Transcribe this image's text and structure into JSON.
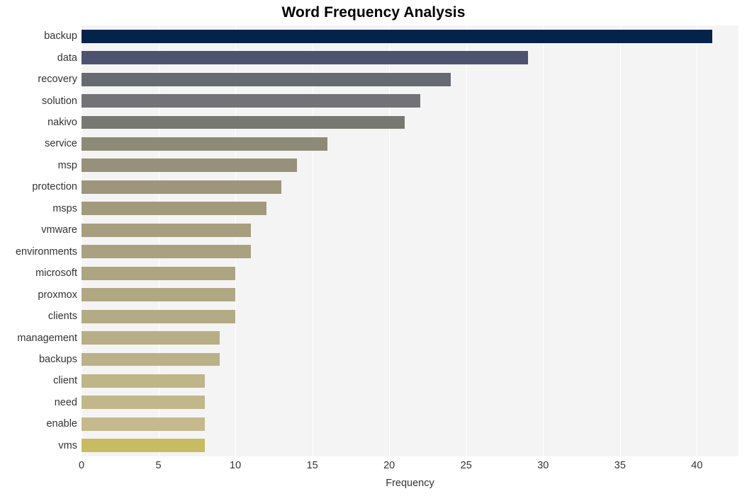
{
  "chart_data": {
    "type": "bar",
    "orientation": "horizontal",
    "title": "Word Frequency Analysis",
    "xlabel": "Frequency",
    "ylabel": "",
    "xlim": [
      0,
      42.7
    ],
    "xticks": [
      0,
      5,
      10,
      15,
      20,
      25,
      30,
      35,
      40
    ],
    "xticklabels": [
      "0",
      "5",
      "10",
      "15",
      "20",
      "25",
      "30",
      "35",
      "40"
    ],
    "grid": "vertical-only",
    "legend": "none",
    "categories": [
      "backup",
      "data",
      "recovery",
      "solution",
      "nakivo",
      "service",
      "msp",
      "protection",
      "msps",
      "vmware",
      "environments",
      "microsoft",
      "proxmox",
      "clients",
      "management",
      "backups",
      "client",
      "need",
      "enable",
      "vms"
    ],
    "values": [
      41,
      29,
      24,
      22,
      21,
      16,
      14,
      13,
      12,
      11,
      11,
      10,
      10,
      10,
      9,
      9,
      8,
      8,
      8,
      8
    ],
    "bar_colors": [
      "#03234b",
      "#4d5271",
      "#666a71",
      "#727277",
      "#787872",
      "#8d8a78",
      "#97917b",
      "#9d967d",
      "#a29a7d",
      "#a69e7f",
      "#a9a180",
      "#ada581",
      "#b0a783",
      "#b3ab85",
      "#b7ae86",
      "#bab188",
      "#beb589",
      "#c1b78b",
      "#c4ba8c",
      "#c7bc64"
    ],
    "plot_background": "#f4f4f4",
    "gridline_color": "#ffffff",
    "figure_background": "#ffffff"
  }
}
